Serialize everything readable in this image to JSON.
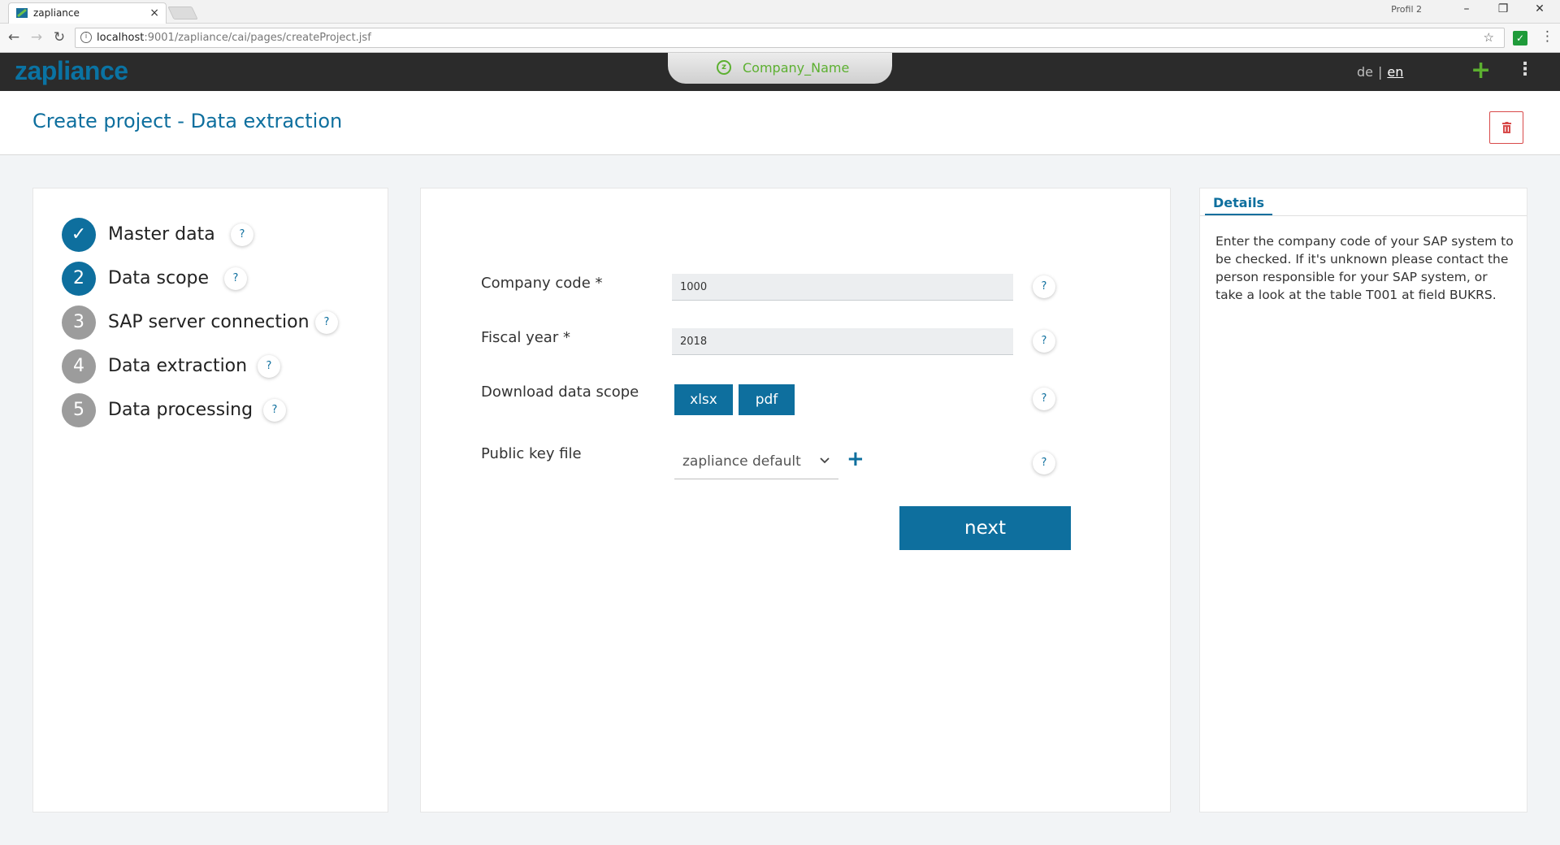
{
  "browser": {
    "tab_title": "zapliance",
    "tab_close": "×",
    "profile": "Profil 2",
    "window_controls": [
      "–",
      "❐",
      "✕"
    ],
    "url_host": "localhost",
    "url_path": ":9001/zapliance/cai/pages/createProject.jsf"
  },
  "header": {
    "logo": "zapliance",
    "company": "Company_Name",
    "lang_de": "de",
    "lang_sep": "|",
    "lang_en": "en",
    "add_icon": "+",
    "menu_icon": "⋮"
  },
  "page": {
    "title": "Create project - Data extraction"
  },
  "steps": [
    {
      "number": "✓",
      "label": "Master data",
      "state": "done"
    },
    {
      "number": "2",
      "label": "Data scope",
      "state": "current"
    },
    {
      "number": "3",
      "label": "SAP server connection",
      "state": "todo"
    },
    {
      "number": "4",
      "label": "Data extraction",
      "state": "todo"
    },
    {
      "number": "5",
      "label": "Data processing",
      "state": "todo"
    }
  ],
  "help_mark": "?",
  "form": {
    "company_code_label": "Company code  *",
    "company_code_value": "1000",
    "fiscal_year_label": "Fiscal year  *",
    "fiscal_year_value": "2018",
    "download_label": "Download data scope",
    "xlsx_label": "xlsx",
    "pdf_label": "pdf",
    "public_key_label": "Public key file",
    "public_key_value": "zapliance default",
    "add_key_icon": "+",
    "next_label": "next"
  },
  "details": {
    "tab_label": "Details",
    "text": "Enter the company code of your SAP system to be checked. If it's unknown please contact the person responsible for your SAP system, or take a look at the table T001 at field BUKRS."
  },
  "colors": {
    "primary": "#0e6f9e",
    "accent_green": "#5cb030",
    "danger": "#d84a4a",
    "header_bg": "#2b2b2b"
  }
}
